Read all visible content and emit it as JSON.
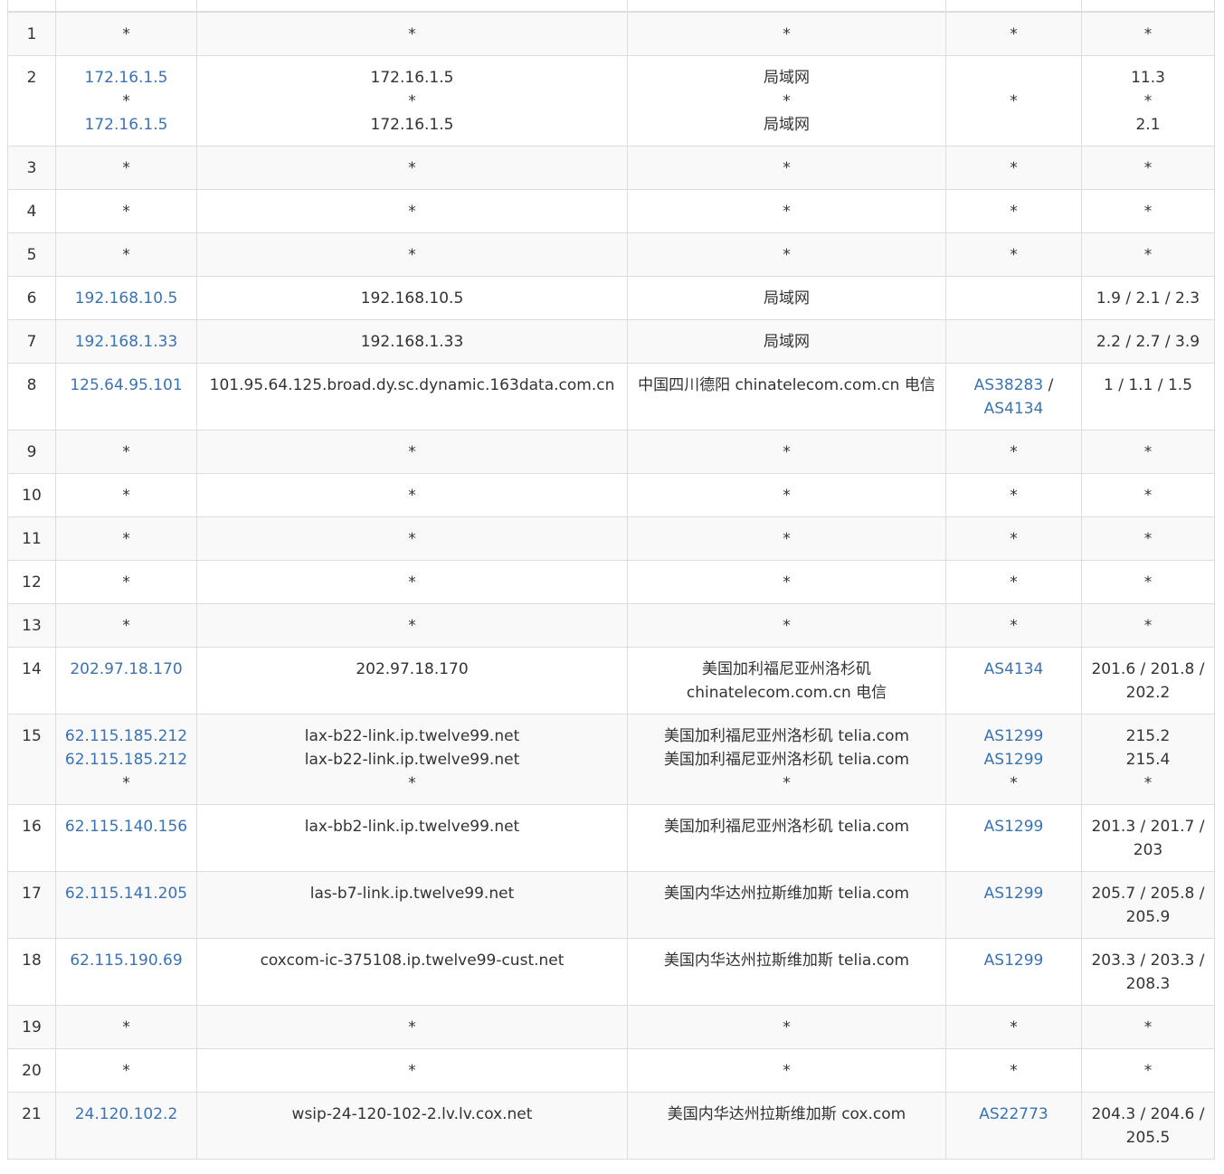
{
  "rows": [
    {
      "hop": "1",
      "ip": [
        "*"
      ],
      "host": [
        "*"
      ],
      "loc": [
        "*"
      ],
      "asn": [
        "*"
      ],
      "rtt": [
        "*"
      ]
    },
    {
      "hop": "2",
      "ip": [
        "172.16.1.5",
        "*",
        "172.16.1.5"
      ],
      "host": [
        "172.16.1.5",
        "*",
        "172.16.1.5"
      ],
      "loc": [
        "局域网",
        "*",
        "局域网"
      ],
      "asn": [
        "*"
      ],
      "asn_center": true,
      "rtt": [
        "11.3",
        "*",
        "2.1"
      ]
    },
    {
      "hop": "3",
      "ip": [
        "*"
      ],
      "host": [
        "*"
      ],
      "loc": [
        "*"
      ],
      "asn": [
        "*"
      ],
      "rtt": [
        "*"
      ]
    },
    {
      "hop": "4",
      "ip": [
        "*"
      ],
      "host": [
        "*"
      ],
      "loc": [
        "*"
      ],
      "asn": [
        "*"
      ],
      "rtt": [
        "*"
      ]
    },
    {
      "hop": "5",
      "ip": [
        "*"
      ],
      "host": [
        "*"
      ],
      "loc": [
        "*"
      ],
      "asn": [
        "*"
      ],
      "rtt": [
        "*"
      ]
    },
    {
      "hop": "6",
      "ip": [
        "192.168.10.5"
      ],
      "host": [
        "192.168.10.5"
      ],
      "loc": [
        "局域网"
      ],
      "asn": [],
      "rtt": [
        "1.9 / 2.1 / 2.3"
      ]
    },
    {
      "hop": "7",
      "ip": [
        "192.168.1.33"
      ],
      "host": [
        "192.168.1.33"
      ],
      "loc": [
        "局域网"
      ],
      "asn": [],
      "rtt": [
        "2.2 / 2.7 / 3.9"
      ]
    },
    {
      "hop": "8",
      "ip": [
        "125.64.95.101"
      ],
      "host": [
        "101.95.64.125.broad.dy.sc.dynamic.163data.com.cn"
      ],
      "loc": [
        "中国四川德阳 chinatelecom.com.cn 电信"
      ],
      "asn_links": [
        "AS38283",
        "AS4134"
      ],
      "asn_sep": " / ",
      "rtt": [
        "1 / 1.1 / 1.5"
      ]
    },
    {
      "hop": "9",
      "ip": [
        "*"
      ],
      "host": [
        "*"
      ],
      "loc": [
        "*"
      ],
      "asn": [
        "*"
      ],
      "rtt": [
        "*"
      ]
    },
    {
      "hop": "10",
      "ip": [
        "*"
      ],
      "host": [
        "*"
      ],
      "loc": [
        "*"
      ],
      "asn": [
        "*"
      ],
      "rtt": [
        "*"
      ]
    },
    {
      "hop": "11",
      "ip": [
        "*"
      ],
      "host": [
        "*"
      ],
      "loc": [
        "*"
      ],
      "asn": [
        "*"
      ],
      "rtt": [
        "*"
      ]
    },
    {
      "hop": "12",
      "ip": [
        "*"
      ],
      "host": [
        "*"
      ],
      "loc": [
        "*"
      ],
      "asn": [
        "*"
      ],
      "rtt": [
        "*"
      ]
    },
    {
      "hop": "13",
      "ip": [
        "*"
      ],
      "host": [
        "*"
      ],
      "loc": [
        "*"
      ],
      "asn": [
        "*"
      ],
      "rtt": [
        "*"
      ]
    },
    {
      "hop": "14",
      "ip": [
        "202.97.18.170"
      ],
      "host": [
        "202.97.18.170"
      ],
      "loc": [
        "美国加利福尼亚州洛杉矶 chinatelecom.com.cn 电信"
      ],
      "asn": [
        "AS4134"
      ],
      "rtt": [
        "201.6 / 201.8 / 202.2"
      ]
    },
    {
      "hop": "15",
      "ip": [
        "62.115.185.212",
        "62.115.185.212",
        "*"
      ],
      "host": [
        "lax-b22-link.ip.twelve99.net",
        "lax-b22-link.ip.twelve99.net",
        "*"
      ],
      "loc": [
        "美国加利福尼亚州洛杉矶 telia.com",
        "美国加利福尼亚州洛杉矶 telia.com",
        "*"
      ],
      "asn": [
        "AS1299",
        "AS1299",
        "*"
      ],
      "rtt": [
        "215.2",
        "215.4",
        "*"
      ]
    },
    {
      "hop": "16",
      "ip": [
        "62.115.140.156"
      ],
      "host": [
        "lax-bb2-link.ip.twelve99.net"
      ],
      "loc": [
        "美国加利福尼亚州洛杉矶 telia.com"
      ],
      "asn": [
        "AS1299"
      ],
      "rtt": [
        "201.3 / 201.7 / 203"
      ]
    },
    {
      "hop": "17",
      "ip": [
        "62.115.141.205"
      ],
      "host": [
        "las-b7-link.ip.twelve99.net"
      ],
      "loc": [
        "美国内华达州拉斯维加斯 telia.com"
      ],
      "asn": [
        "AS1299"
      ],
      "rtt": [
        "205.7 / 205.8 / 205.9"
      ]
    },
    {
      "hop": "18",
      "ip": [
        "62.115.190.69"
      ],
      "host": [
        "coxcom-ic-375108.ip.twelve99-cust.net"
      ],
      "loc": [
        "美国内华达州拉斯维加斯 telia.com"
      ],
      "asn": [
        "AS1299"
      ],
      "rtt": [
        "203.3 / 203.3 / 208.3"
      ]
    },
    {
      "hop": "19",
      "ip": [
        "*"
      ],
      "host": [
        "*"
      ],
      "loc": [
        "*"
      ],
      "asn": [
        "*"
      ],
      "rtt": [
        "*"
      ]
    },
    {
      "hop": "20",
      "ip": [
        "*"
      ],
      "host": [
        "*"
      ],
      "loc": [
        "*"
      ],
      "asn": [
        "*"
      ],
      "rtt": [
        "*"
      ]
    },
    {
      "hop": "21",
      "ip": [
        "24.120.102.2"
      ],
      "host": [
        "wsip-24-120-102-2.lv.lv.cox.net"
      ],
      "loc": [
        "美国内华达州拉斯维加斯 cox.com"
      ],
      "asn": [
        "AS22773"
      ],
      "rtt": [
        "204.3 / 204.6 / 205.5"
      ]
    }
  ]
}
